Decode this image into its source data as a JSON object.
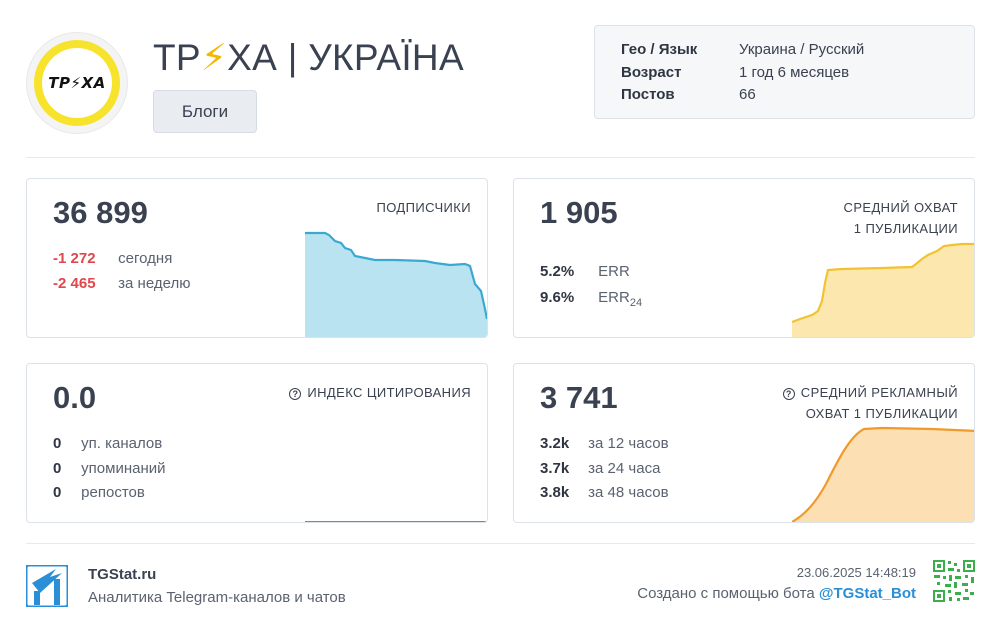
{
  "channel": {
    "logo_text": "TP⚡XA",
    "title_part1": "ТР",
    "title_bolt": "⚡",
    "title_part2": "ХА | УКРАЇНА",
    "category": "Блоги"
  },
  "info": [
    {
      "label": "Гео / Язык",
      "value": "Украина / Русский"
    },
    {
      "label": "Возраст",
      "value": "1 год 6 месяцев"
    },
    {
      "label": "Постов",
      "value": "66"
    }
  ],
  "subscribers": {
    "value": "36 899",
    "label": "ПОДПИСЧИКИ",
    "today_num": "-1 272",
    "today_txt": "сегодня",
    "week_num": "-2 465",
    "week_txt": "за неделю",
    "color": "#3aa9d0"
  },
  "reach": {
    "value": "1 905",
    "label_line1": "СРЕДНИЙ ОХВАТ",
    "label_line2": "1 ПУБЛИКАЦИИ",
    "err_num": "5.2%",
    "err_txt": "ERR",
    "err24_num": "9.6%",
    "err24_txt": "ERR",
    "err24_sub": "24",
    "color": "#f2c94c"
  },
  "citation": {
    "value": "0.0",
    "label": "ИНДЕКС ЦИТИРОВАНИЯ",
    "rows": [
      {
        "num": "0",
        "txt": "уп. каналов"
      },
      {
        "num": "0",
        "txt": "упоминаний"
      },
      {
        "num": "0",
        "txt": "репостов"
      }
    ],
    "color": "#4caf50"
  },
  "ad_reach": {
    "value": "3 741",
    "label_line1": "СРЕДНИЙ РЕКЛАМНЫЙ",
    "label_line2": "ОХВАТ 1 ПУБЛИКАЦИИ",
    "rows": [
      {
        "num": "3.2k",
        "txt": "за 12 часов"
      },
      {
        "num": "3.7k",
        "txt": "за 24 часа"
      },
      {
        "num": "3.8k",
        "txt": "за 48 часов"
      }
    ],
    "color": "#ef9a2b"
  },
  "footer": {
    "site": "TGStat.ru",
    "tagline": "Аналитика Telegram-каналов и чатов",
    "datetime": "23.06.2025 14:48:19",
    "made_with": "Создано с помощью бота ",
    "bot": "@TGStat_Bot"
  }
}
